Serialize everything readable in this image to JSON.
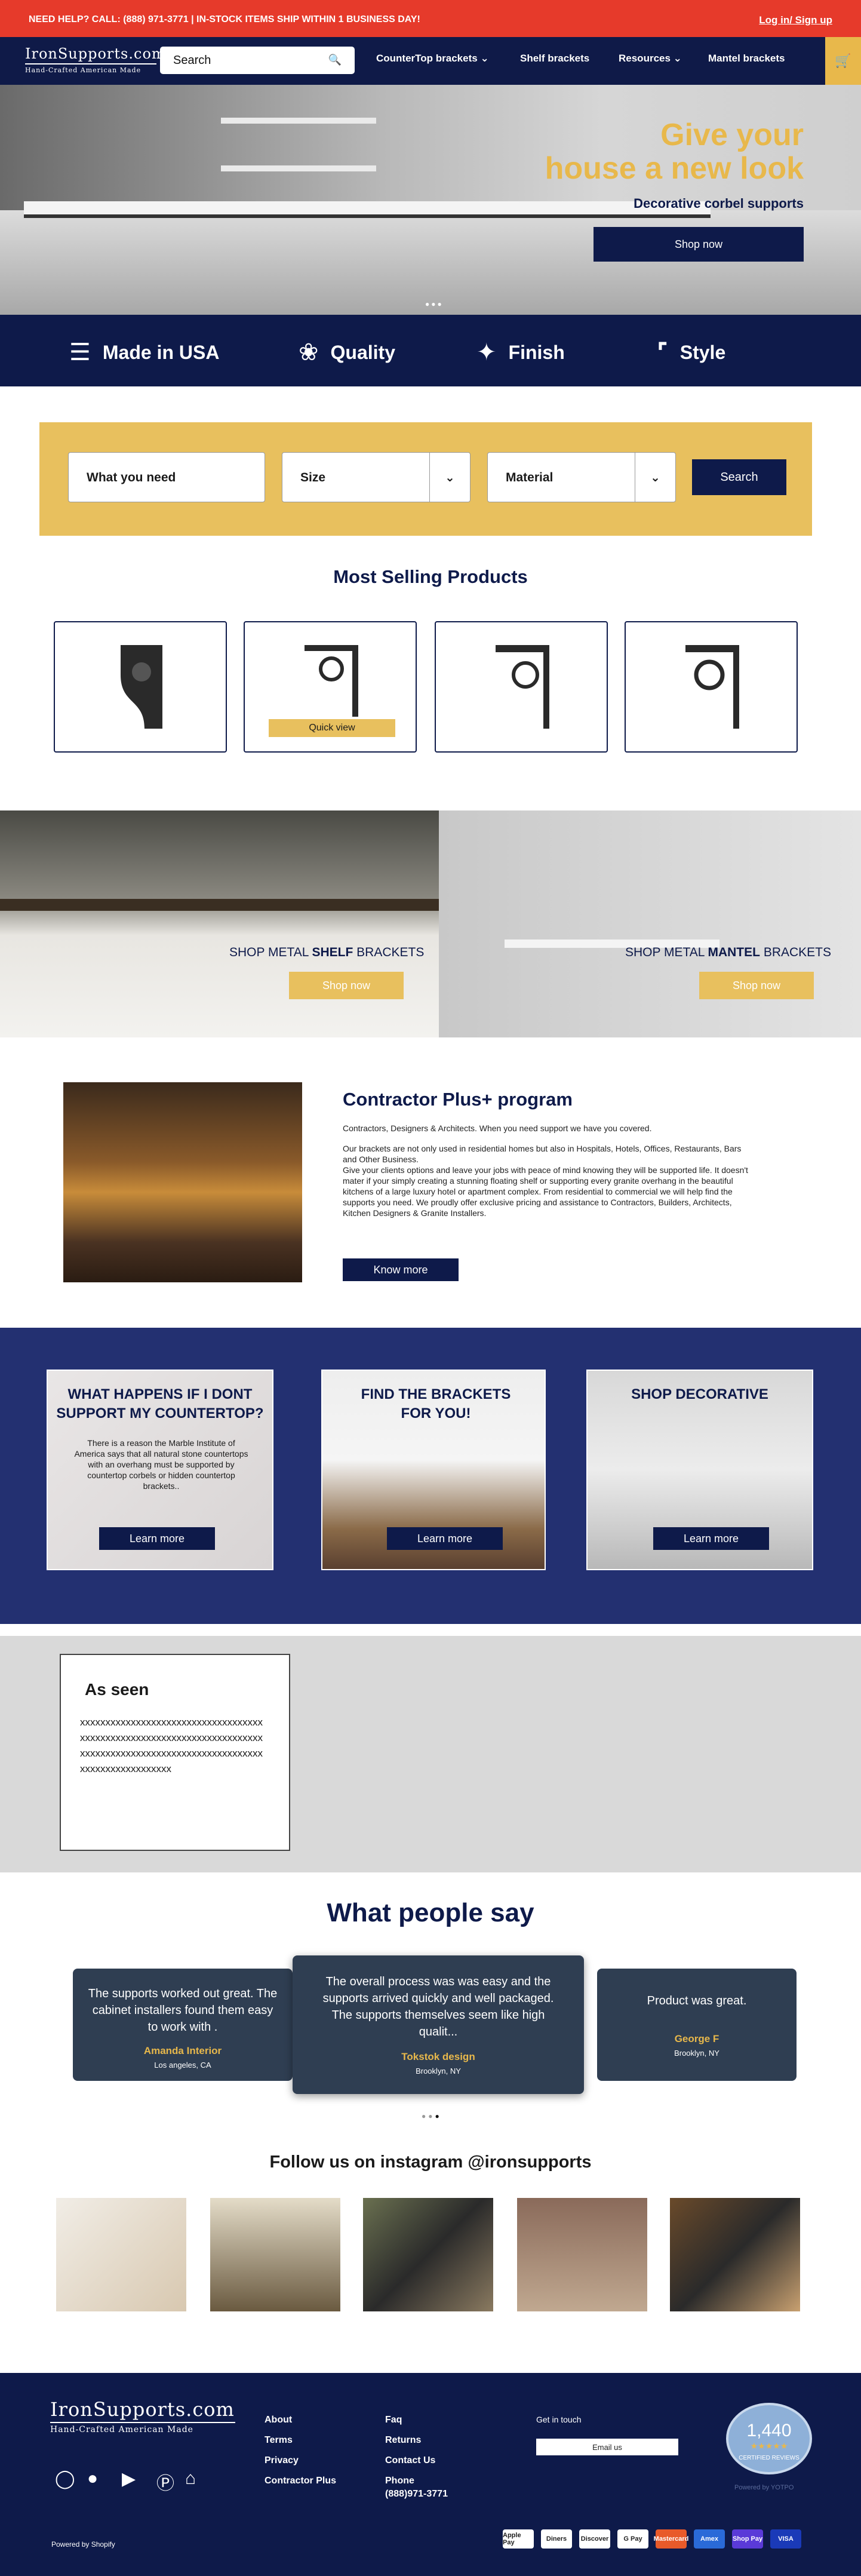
{
  "topbar": {
    "left": "NEED HELP? CALL: (888) 971-3771 | IN-STOCK ITEMS SHIP WITHIN 1 BUSINESS DAY!",
    "right": "Log in/ Sign up"
  },
  "header": {
    "logo_main": "IronSupports.com",
    "logo_sub": "Hand-Crafted  American Made",
    "search_placeholder": "Search",
    "nav": [
      "CounterTop brackets",
      "Shelf brackets",
      "Resources",
      "Mantel brackets"
    ]
  },
  "hero": {
    "title1": "Give  your",
    "title2": "house a new look",
    "subtitle": "Decorative corbel supports",
    "button": "Shop now"
  },
  "features": [
    "Made in USA",
    "Quality",
    "Finish",
    "Style"
  ],
  "filter": {
    "need": "What you need",
    "size": "Size",
    "material": "Material",
    "button": "Search"
  },
  "most_selling": {
    "title": "Most Selling Products",
    "quick_view": "Quick view"
  },
  "banners": [
    {
      "label_pre": "SHOP METAL ",
      "label_bold": "SHELF",
      "label_post": " BRACKETS",
      "button": "Shop now"
    },
    {
      "label_pre": "SHOP METAL ",
      "label_bold": "MANTEL",
      "label_post": " BRACKETS",
      "button": "Shop now"
    }
  ],
  "contractor": {
    "title": "Contractor Plus+ program",
    "p1": "Contractors, Designers & Architects. When you need support we have you covered.",
    "p2": "Our brackets are not only used in residential homes but also in Hospitals, Hotels, Offices, Restaurants, Bars and Other Business.",
    "p3": "Give your clients options and leave your jobs with peace of mind knowing they will be supported life.  It doesn't mater if your simply creating a stunning floating shelf or supporting every granite overhang in the beautiful kitchens of a large luxury hotel or apartment complex. From residential to commercial we will help find the supports you need. We proudly offer exclusive pricing and assistance to Contractors, Builders, Architects, Kitchen Designers & Granite Installers.",
    "button": "Know more"
  },
  "cards": [
    {
      "title": "WHAT HAPPENS IF I DONT SUPPORT MY COUNTERTOP?",
      "text": "There is a reason the Marble Institute of America says that all natural stone countertops with an overhang must be supported by countertop corbels or hidden countertop brackets..",
      "button": "Learn more"
    },
    {
      "title": "FIND THE BRACKETS FOR YOU!",
      "button": "Learn more"
    },
    {
      "title": "SHOP DECORATIVE",
      "button": "Learn more"
    }
  ],
  "as_seen": {
    "title": "As seen",
    "text": "xxxxxxxxxxxxxxxxxxxxxxxxxxxxxxxxxxxxxxxxxxxxxxxxxxxxxxxxxxxxxxxxxxxxxxxxxxxxxxxxxxxxxxxxxxxxxxxxxxxxxxxxxxxxxxxxxxxxxxxxxxxxxx"
  },
  "testimonials": {
    "title": "What people say",
    "items": [
      {
        "quote": "The supports worked out great. The cabinet installers found them easy to work with .",
        "name": "Amanda Interior",
        "city": "Los angeles, CA"
      },
      {
        "quote": "The overall process was was easy and the supports arrived quickly and well packaged. The supports themselves seem like high qualit...",
        "name": "Tokstok design",
        "city": "Brooklyn, NY"
      },
      {
        "quote": "Product was great.",
        "name": "George F",
        "city": "Brooklyn, NY"
      }
    ]
  },
  "instagram": {
    "title": "Follow us on instagram @ironsupports"
  },
  "footer": {
    "col1": [
      "About",
      "Terms",
      "Privacy",
      "Contractor Plus"
    ],
    "col2": [
      "Faq",
      "Returns",
      "Contact Us",
      "Phone"
    ],
    "phone": "(888)971-3771",
    "get_in_touch": "Get in touch",
    "email_button": "Email us",
    "reviews_count": "1,440",
    "reviews_label": "CERTIFIED REVIEWS",
    "powered_yotpo": "Powered by YOTPO",
    "powered": "Powered by Shopify",
    "payments": [
      "Apple Pay",
      "Diners",
      "Discover",
      "G Pay",
      "Mastercard",
      "Amex",
      "Shop Pay",
      "VISA"
    ]
  },
  "colors": {
    "navy": "#0e1a4a",
    "gold": "#e8b84b",
    "red": "#e63a2b",
    "blue": "#233071"
  }
}
